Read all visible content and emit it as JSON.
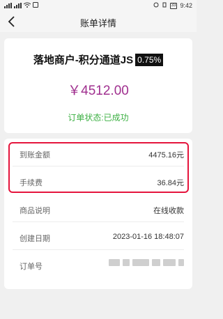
{
  "status_bar": {
    "time": "9:42",
    "battery": "33"
  },
  "header": {
    "title": "账单详情"
  },
  "summary": {
    "merchant": "落地商户-积分通道JS",
    "rate": "0.75%",
    "amount": "￥4512.00",
    "order_status": "订单状态:已成功"
  },
  "details": [
    {
      "label": "到账金额",
      "value": "4475.16元"
    },
    {
      "label": "手续费",
      "value": "36.84元"
    },
    {
      "label": "商品说明",
      "value": "在线收款"
    },
    {
      "label": "创建日期",
      "value": "2023-01-16 18:48:07"
    },
    {
      "label": "订单号",
      "value": ""
    }
  ],
  "colors": {
    "amount": "#a0308f",
    "status": "#3cb043",
    "highlight": "#e5143c"
  }
}
